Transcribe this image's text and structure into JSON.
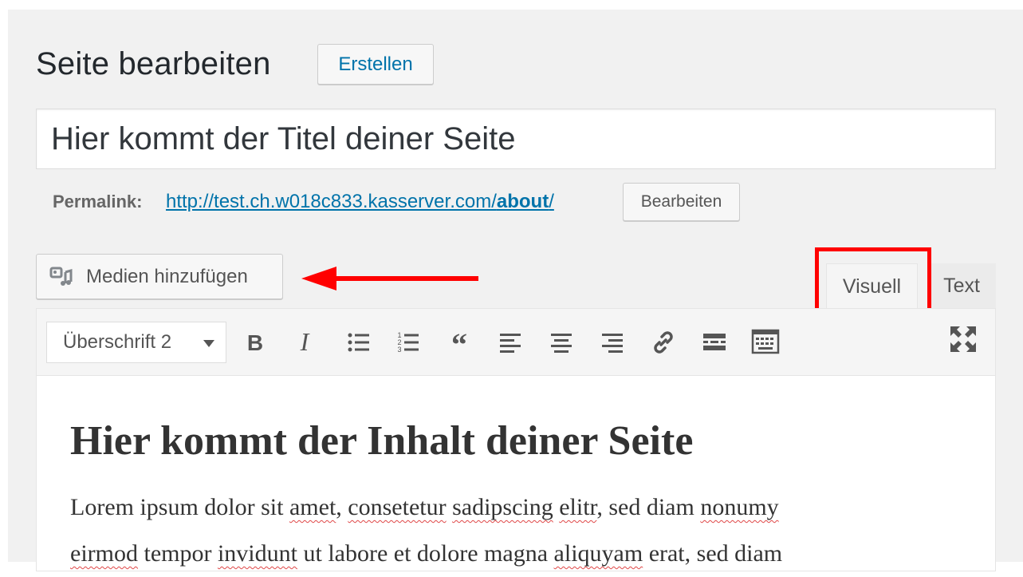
{
  "header": {
    "title": "Seite bearbeiten",
    "create_button": "Erstellen"
  },
  "title_field": {
    "value": "Hier kommt der Titel deiner Seite"
  },
  "permalink": {
    "label": "Permalink:",
    "url_prefix": "http://test.ch.w018c833.kasserver.com/",
    "url_slug": "about",
    "url_suffix": "/",
    "edit_button": "Bearbeiten"
  },
  "media": {
    "add_media_button": "Medien hinzufügen"
  },
  "editor_tabs": {
    "visual": "Visuell",
    "text": "Text"
  },
  "toolbar": {
    "format_select": "Überschrift 2",
    "buttons": [
      "bold-icon",
      "italic-icon",
      "bulleted-list-icon",
      "numbered-list-icon",
      "blockquote-icon",
      "align-left-icon",
      "align-center-icon",
      "align-right-icon",
      "link-icon",
      "read-more-icon",
      "toolbar-toggle-icon",
      "fullscreen-icon"
    ]
  },
  "content": {
    "heading": "Hier kommt der Inhalt deiner Seite",
    "line1": {
      "t1": "Lorem ipsum dolor sit ",
      "w1": "amet",
      "t2": ", ",
      "w2": "consetetur",
      "t3": " ",
      "w3": "sadipscing",
      "t4": " ",
      "w4": "elitr",
      "t5": ", sed diam ",
      "w5": "nonumy"
    },
    "line2": {
      "w1": "eirmod",
      "t1": " tempor ",
      "w2": "invidunt",
      "t2": " ut labore et dolore magna ",
      "w3": "aliquyam",
      "t3": " erat, sed diam"
    }
  },
  "colors": {
    "link": "#0073aa",
    "highlight": "#ff0000",
    "arrow": "#ff0000",
    "spellcheck": "#e04848"
  }
}
